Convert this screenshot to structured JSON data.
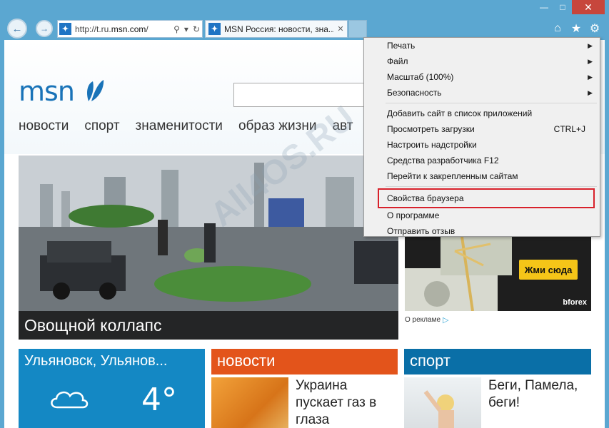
{
  "browser": {
    "address_url_prefix": "http://t.ru.",
    "address_url_domain": "msn.com",
    "address_url_suffix": "/",
    "tab_title": "MSN Россия: новости, зна...",
    "favicon_letter": "■"
  },
  "page": {
    "logo": "msn",
    "nav": [
      "новости",
      "спорт",
      "знаменитости",
      "образ жизни",
      "авт"
    ],
    "hero_caption": "Овощной коллапс",
    "ad": {
      "cta": "Жми сюда",
      "brand": "bforex",
      "note": "О рекламе"
    },
    "weather": {
      "city": "Ульяновск, Ульянов...",
      "temperature": "4°"
    },
    "news": {
      "header": "новости",
      "headline_line1": "Украина",
      "headline_line2": "пускает газ в",
      "headline_line3": "глаза"
    },
    "sport": {
      "header": "спорт",
      "headline_line1": "Беги, Памела,",
      "headline_line2": "беги!"
    },
    "watermark": "All4OS.RU"
  },
  "menu": {
    "items": [
      {
        "label": "Печать",
        "submenu": true
      },
      {
        "label": "Файл",
        "submenu": true
      },
      {
        "label": "Масштаб (100%)",
        "submenu": true
      },
      {
        "label": "Безопасность",
        "submenu": true
      },
      {
        "label": "Добавить сайт в список приложений"
      },
      {
        "label": "Просмотреть загрузки",
        "shortcut": "CTRL+J"
      },
      {
        "label": "Настроить надстройки"
      },
      {
        "label": "Средства разработчика F12"
      },
      {
        "label": "Перейти к закрепленным сайтам"
      },
      {
        "label": "Свойства браузера",
        "highlighted": true
      },
      {
        "label": "О программе"
      },
      {
        "label": "Отправить отзыв"
      }
    ]
  },
  "colors": {
    "frame": "#5ba7d1",
    "close_button": "#c7463c",
    "weather_tile": "#1488c4",
    "news_tile": "#e3541b",
    "sport_tile": "#0a6fa7",
    "highlight_outline": "#d8212b"
  }
}
